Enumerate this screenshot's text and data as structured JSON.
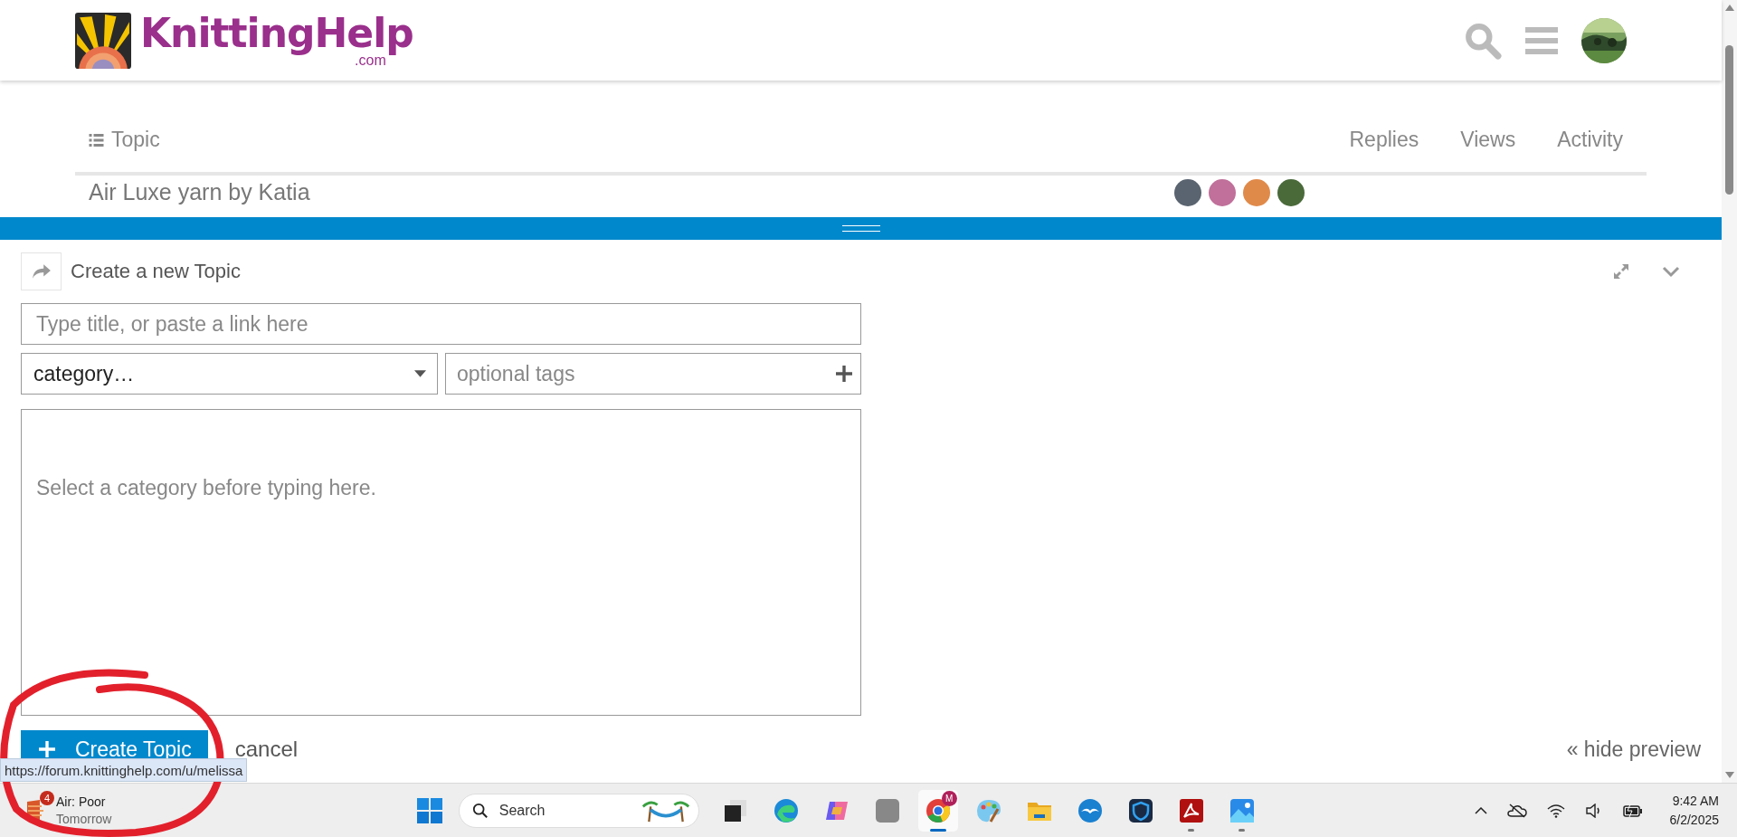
{
  "header": {
    "logo": {
      "name": "KnittingHelp",
      "domain": ".com"
    }
  },
  "topic_list": {
    "columns": [
      {
        "label": "Topic",
        "kind": "main"
      },
      {
        "label": "Replies",
        "kind": "stat"
      },
      {
        "label": "Views",
        "kind": "stat"
      },
      {
        "label": "Activity",
        "kind": "stat"
      }
    ],
    "rows": [
      {
        "title": "Air Luxe yarn by Katia",
        "posters": [
          {
            "color": "#5a6470"
          },
          {
            "color": "#c0709a"
          },
          {
            "color": "#e08a4a"
          },
          {
            "color": "#4a6a3a"
          }
        ]
      }
    ]
  },
  "composer": {
    "title": "Create a new Topic",
    "title_field": {
      "placeholder": "Type title, or paste a link here"
    },
    "category": {
      "value": "category…"
    },
    "tags": {
      "placeholder": "optional tags"
    },
    "editor": {
      "placeholder": "Select a category before typing here."
    },
    "submit": "Create Topic",
    "cancel": "cancel",
    "preview_toggle": "« hide preview"
  },
  "status_url": "https://forum.knittinghelp.com/u/melissa",
  "taskbar": {
    "weather": {
      "badge": "4",
      "line1": "Air: Poor",
      "line2": "Tomorrow"
    },
    "search": {
      "placeholder": "Search"
    },
    "apps": [
      {
        "kind": "taskview",
        "selected": false,
        "running": false
      },
      {
        "kind": "edge",
        "selected": false,
        "running": false
      },
      {
        "kind": "copilot",
        "selected": false,
        "running": false
      },
      {
        "kind": "blank",
        "selected": false,
        "running": false
      },
      {
        "kind": "chrome",
        "selected": true,
        "running": true,
        "badge": "M"
      },
      {
        "kind": "paint",
        "selected": false,
        "running": false
      },
      {
        "kind": "folder",
        "selected": false,
        "running": false
      },
      {
        "kind": "bird",
        "selected": false,
        "running": false
      },
      {
        "kind": "shield",
        "selected": false,
        "running": false
      },
      {
        "kind": "pdf",
        "selected": false,
        "running": true
      },
      {
        "kind": "photos",
        "selected": false,
        "running": true
      }
    ],
    "time": "9:42 AM",
    "date": "6/2/2025"
  }
}
